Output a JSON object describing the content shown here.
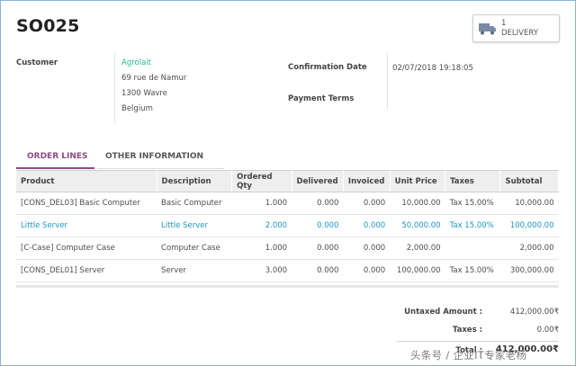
{
  "order": {
    "name": "SO025"
  },
  "smart_button": {
    "count": "1",
    "label": "DELIVERY",
    "icon": "truck-icon"
  },
  "customer": {
    "label": "Customer",
    "name": "Agrolait",
    "street": "69 rue de Namur",
    "city": "1300 Wavre",
    "country": "Belgium"
  },
  "confirmation": {
    "label": "Confirmation Date",
    "value": "02/07/2018 19:18:05"
  },
  "payment_terms": {
    "label": "Payment Terms",
    "value": ""
  },
  "tabs": [
    {
      "label": "ORDER LINES",
      "active": true
    },
    {
      "label": "OTHER INFORMATION",
      "active": false
    }
  ],
  "columns": [
    "Product",
    "Description",
    "Ordered Qty",
    "Delivered",
    "Invoiced",
    "Unit Price",
    "Taxes",
    "Subtotal"
  ],
  "lines": [
    {
      "product": "[CONS_DEL03] Basic Computer",
      "description": "Basic Computer",
      "qty": "1.000",
      "delivered": "0.000",
      "invoiced": "0.000",
      "unit_price": "10,000.00",
      "taxes": "Tax 15.00%",
      "subtotal": "10,000.00"
    },
    {
      "product": "Little Server",
      "description": "Little Server",
      "qty": "2.000",
      "delivered": "0.000",
      "invoiced": "0.000",
      "unit_price": "50,000.00",
      "taxes": "Tax 15.00%",
      "subtotal": "100,000.00"
    },
    {
      "product": "[C-Case] Computer Case",
      "description": "Computer Case",
      "qty": "1.000",
      "delivered": "0.000",
      "invoiced": "0.000",
      "unit_price": "2,000.00",
      "taxes": "",
      "subtotal": "2,000.00"
    },
    {
      "product": "[CONS_DEL01] Server",
      "description": "Server",
      "qty": "3.000",
      "delivered": "0.000",
      "invoiced": "0.000",
      "unit_price": "100,000.00",
      "taxes": "Tax 15.00%",
      "subtotal": "300,000.00"
    }
  ],
  "totals": {
    "untaxed_label": "Untaxed Amount :",
    "untaxed_value": "412,000.00₹",
    "taxes_label": "Taxes :",
    "taxes_value": "0.00₹",
    "total_label": "Total :",
    "total_value": "412,000.00₹"
  },
  "watermark": "头条号 / 企业IT专家老杨",
  "colors": {
    "accent": "#8c4983",
    "link": "#21b799",
    "highlight_row": "#1a96c8"
  }
}
